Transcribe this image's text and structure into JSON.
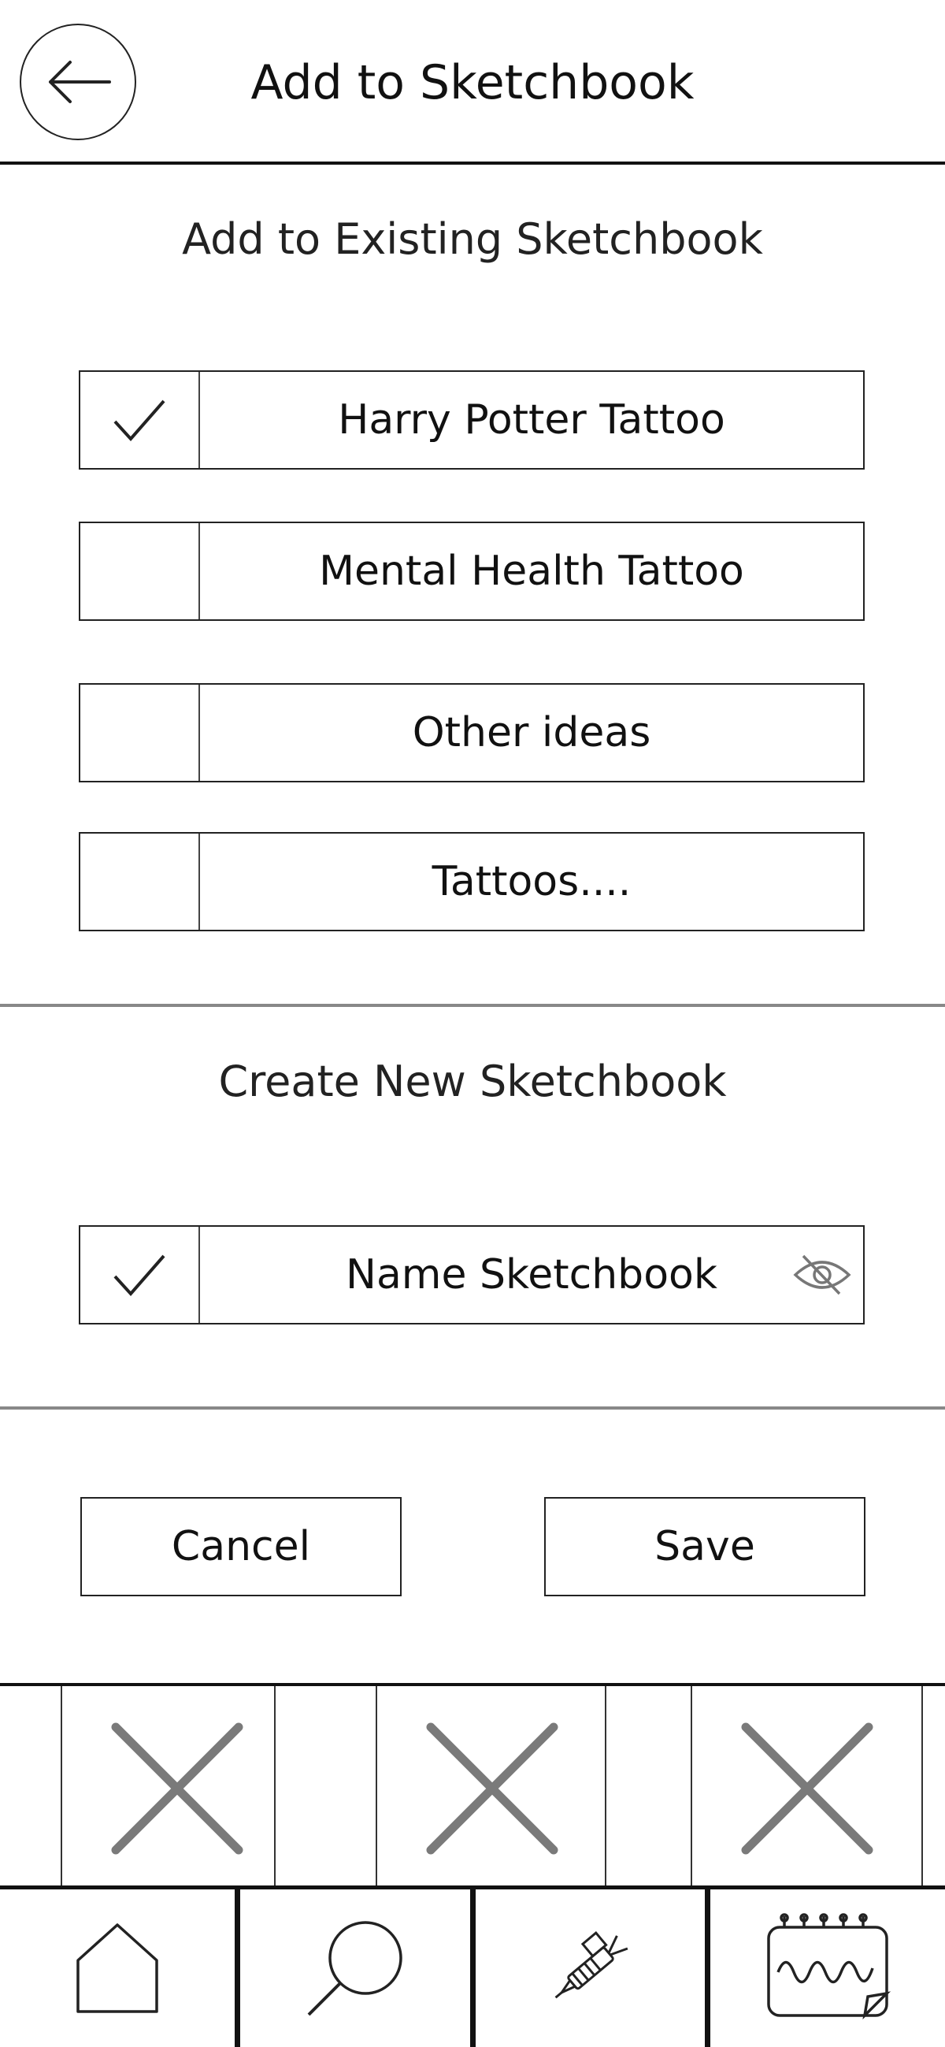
{
  "header": {
    "title": "Add to Sketchbook",
    "back_icon": "arrow-left-icon"
  },
  "existing": {
    "title": "Add to Existing Sketchbook",
    "items": [
      {
        "label": "Harry Potter Tattoo",
        "checked": true
      },
      {
        "label": "Mental Health Tattoo",
        "checked": false
      },
      {
        "label": "Other ideas",
        "checked": false
      },
      {
        "label": "Tattoos....",
        "checked": false
      }
    ]
  },
  "create": {
    "title": "Create New Sketchbook",
    "name_label": "Name Sketchbook",
    "checked": true,
    "visibility_icon": "eye-off-icon"
  },
  "actions": {
    "cancel_label": "Cancel",
    "save_label": "Save"
  },
  "nav": {
    "items": [
      "home-icon",
      "search-icon",
      "tattoo-machine-icon",
      "sketchbook-icon"
    ]
  }
}
